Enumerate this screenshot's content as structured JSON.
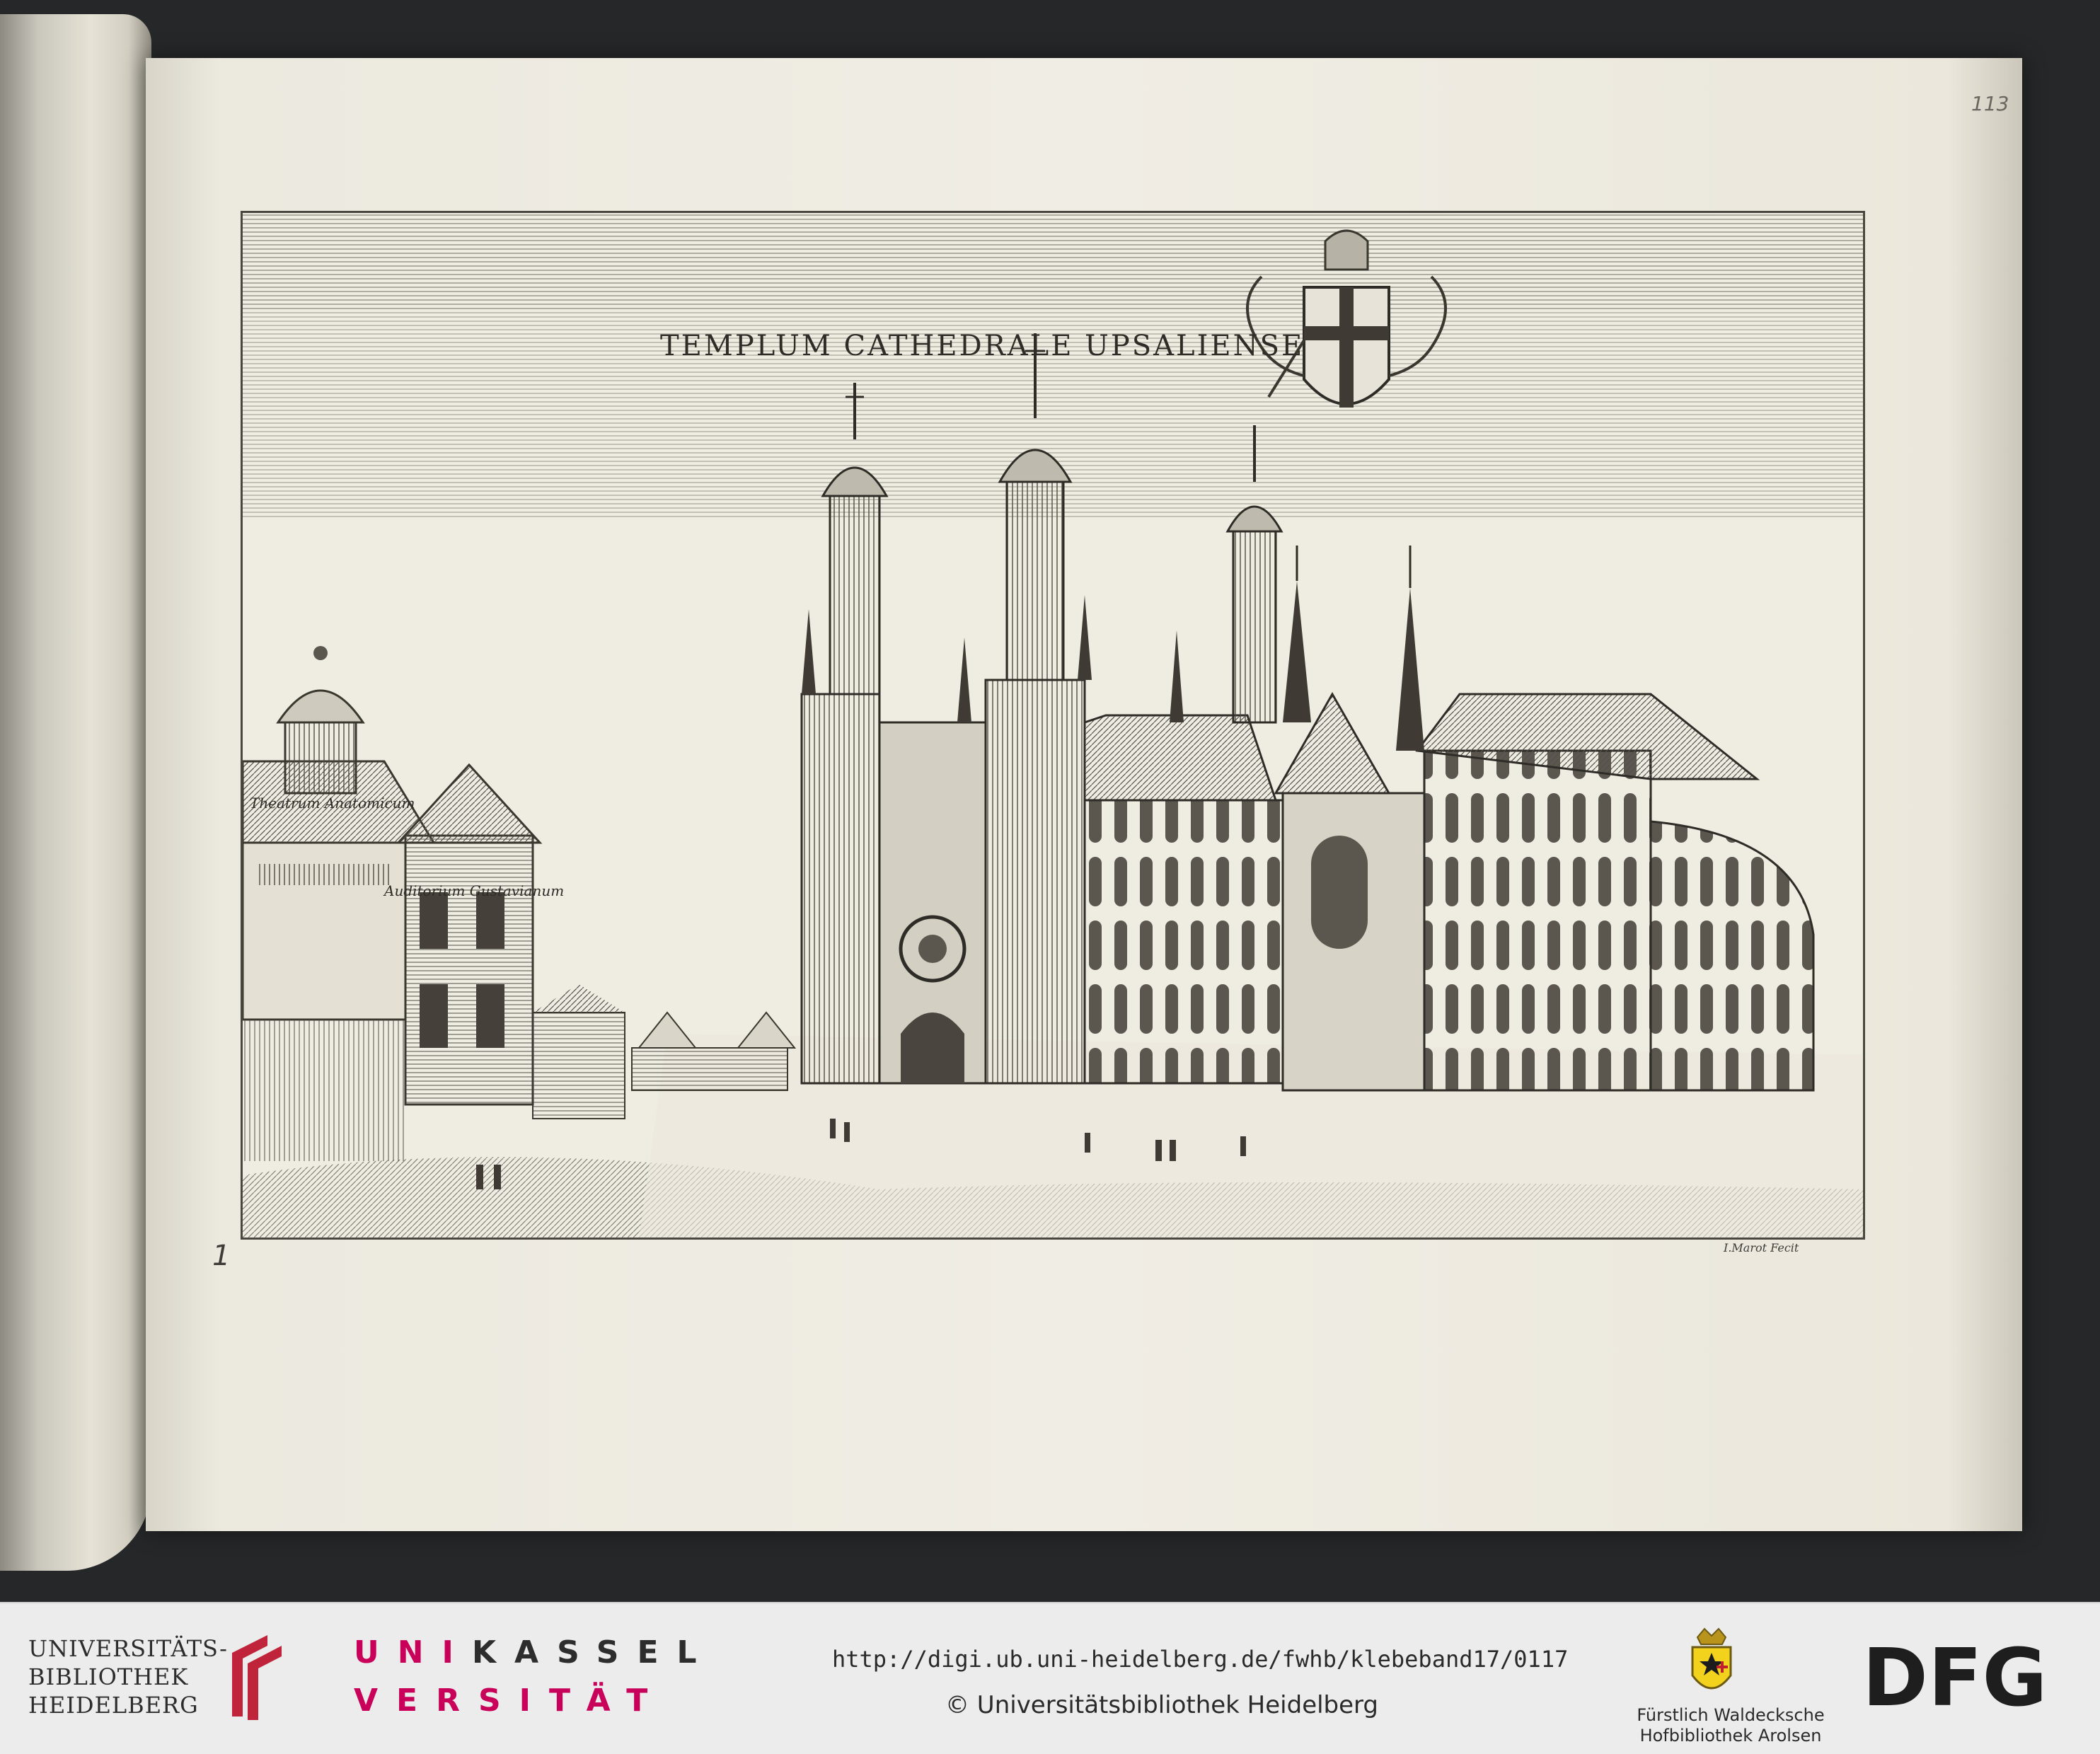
{
  "scan": {
    "folio": "113",
    "plate_number": "1",
    "plate_title": "TEMPLUM CATHEDRALE UPSALIENSE",
    "label_left_dome": "Theatrum Anatomicum",
    "label_left_building": "Auditorium Gustavianum",
    "signature": "I.Marot Fecit"
  },
  "footer": {
    "ub_line1": "UNIVERSITÄTS-",
    "ub_line2": "BIBLIOTHEK",
    "ub_line3": "HEIDELBERG",
    "unikassel_row1_a": "UNI",
    "unikassel_row1_b": "KASSEL",
    "unikassel_row2": "VERSITÄT",
    "url": "http://digi.ub.uni-heidelberg.de/fwhb/klebeband17/0117",
    "copyright": "© Universitätsbibliothek Heidelberg",
    "fw_line1": "Fürstlich Waldecksche",
    "fw_line2": "Hofbibliothek Arolsen",
    "dfg": "DFG"
  },
  "colors": {
    "unikassel_red": "#c8005a",
    "ub_logo_red": "#c0243b",
    "ink": "#2f2c27",
    "paper": "#efece2"
  }
}
